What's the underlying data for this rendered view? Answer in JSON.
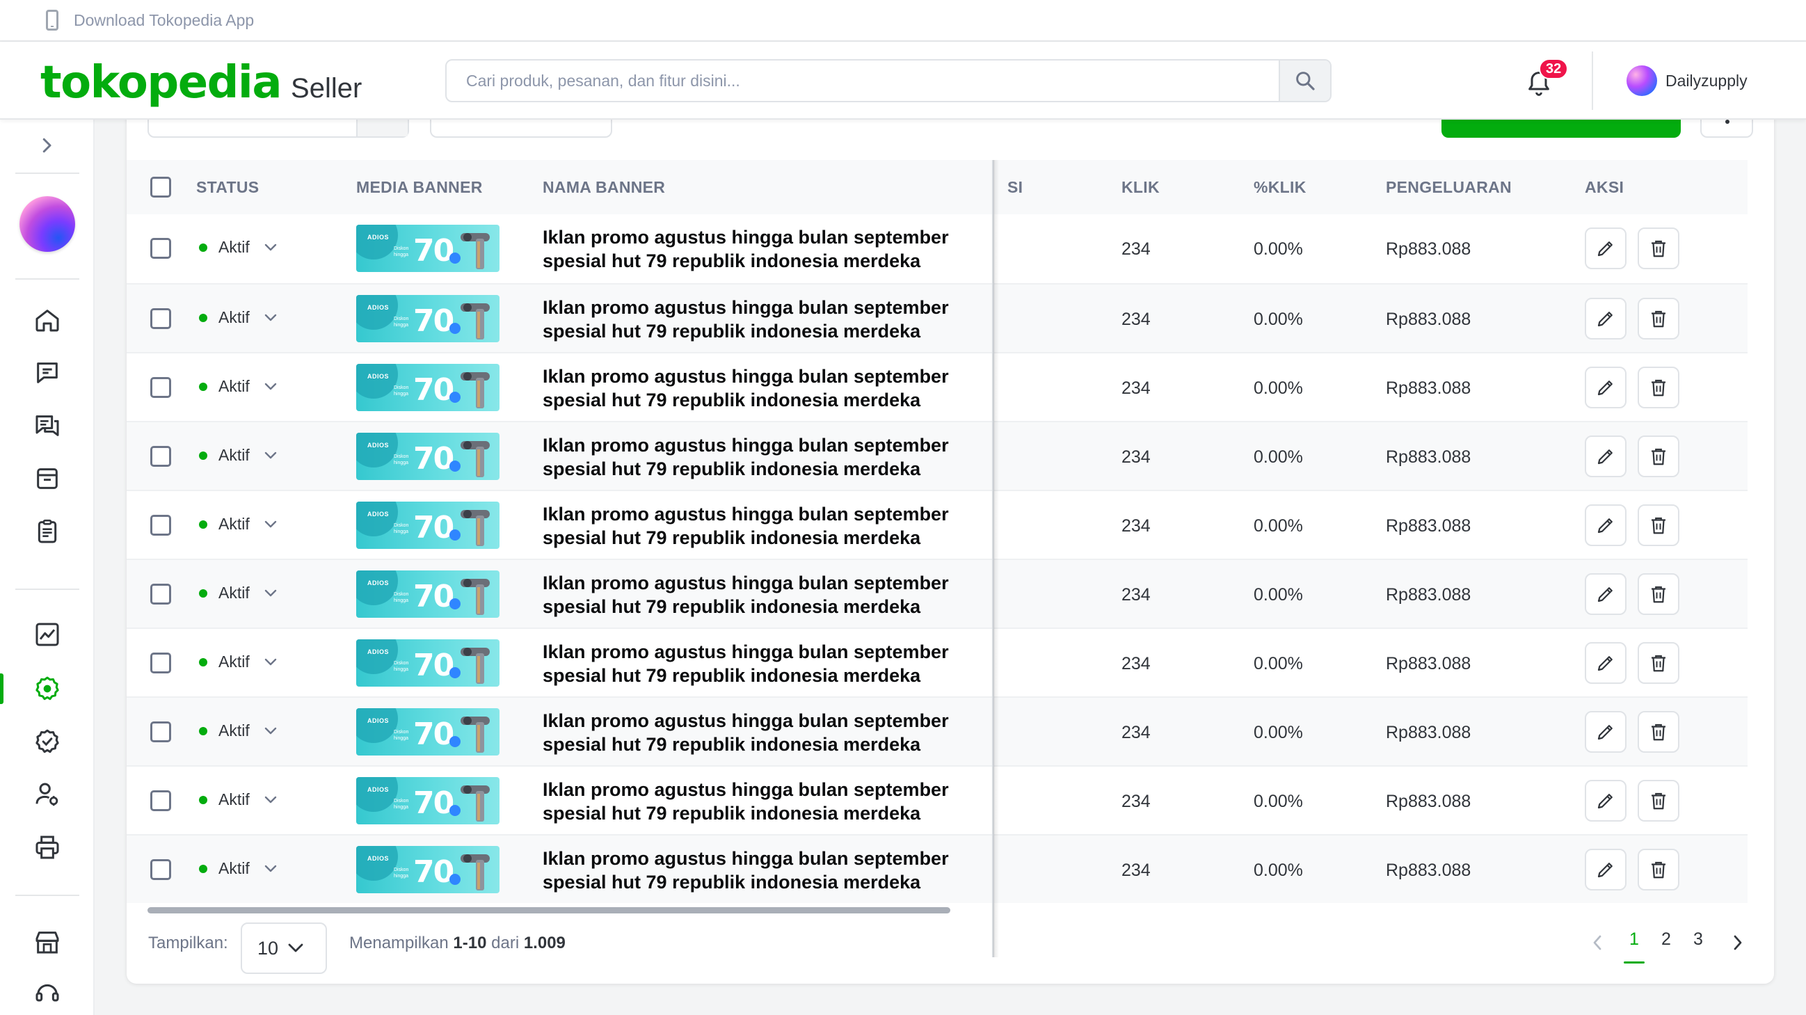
{
  "topbar": {
    "download_label": "Download Tokopedia App"
  },
  "header": {
    "brand": "tokopedia",
    "product": "Seller",
    "search_placeholder": "Cari produk, pesanan, dan fitur disini...",
    "notification_count": "32",
    "username": "Dailyzupply"
  },
  "sidebar": {
    "icons": [
      "home-icon",
      "chat-icon",
      "discussion-icon",
      "store-icon",
      "order-list-icon",
      "statistics-icon",
      "ads-icon",
      "badge-icon",
      "user-settings-icon",
      "printer-icon",
      "shop-decor-icon",
      "support-icon"
    ],
    "active": "ads-icon"
  },
  "table": {
    "headers": {
      "status": "STATUS",
      "media": "MEDIA BANNER",
      "name": "NAMA BANNER",
      "partial": "SI",
      "klik": "KLIK",
      "pct_klik": "%KLIK",
      "spend": "PENGELUARAN",
      "actions": "AKSI"
    },
    "banner_art": {
      "brand": "ADIOS",
      "small1": "Diskon",
      "small2": "hingga",
      "big": "70"
    },
    "rows": [
      {
        "status": "Aktif",
        "name1": "Iklan promo agustus hingga bulan september",
        "name2": "spesial hut 79 republik indonesia merdeka",
        "klik": "234",
        "pct": "0.00%",
        "spend": "Rp883.088"
      },
      {
        "status": "Aktif",
        "name1": "Iklan promo agustus hingga bulan september",
        "name2": "spesial hut 79 republik indonesia merdeka",
        "klik": "234",
        "pct": "0.00%",
        "spend": "Rp883.088"
      },
      {
        "status": "Aktif",
        "name1": "Iklan promo agustus hingga bulan september",
        "name2": "spesial hut 79 republik indonesia merdeka",
        "klik": "234",
        "pct": "0.00%",
        "spend": "Rp883.088"
      },
      {
        "status": "Aktif",
        "name1": "Iklan promo agustus hingga bulan september",
        "name2": "spesial hut 79 republik indonesia merdeka",
        "klik": "234",
        "pct": "0.00%",
        "spend": "Rp883.088"
      },
      {
        "status": "Aktif",
        "name1": "Iklan promo agustus hingga bulan september",
        "name2": "spesial hut 79 republik indonesia merdeka",
        "klik": "234",
        "pct": "0.00%",
        "spend": "Rp883.088"
      },
      {
        "status": "Aktif",
        "name1": "Iklan promo agustus hingga bulan september",
        "name2": "spesial hut 79 republik indonesia merdeka",
        "klik": "234",
        "pct": "0.00%",
        "spend": "Rp883.088"
      },
      {
        "status": "Aktif",
        "name1": "Iklan promo agustus hingga bulan september",
        "name2": "spesial hut 79 republik indonesia merdeka",
        "klik": "234",
        "pct": "0.00%",
        "spend": "Rp883.088"
      },
      {
        "status": "Aktif",
        "name1": "Iklan promo agustus hingga bulan september",
        "name2": "spesial hut 79 republik indonesia merdeka",
        "klik": "234",
        "pct": "0.00%",
        "spend": "Rp883.088"
      },
      {
        "status": "Aktif",
        "name1": "Iklan promo agustus hingga bulan september",
        "name2": "spesial hut 79 republik indonesia merdeka",
        "klik": "234",
        "pct": "0.00%",
        "spend": "Rp883.088"
      },
      {
        "status": "Aktif",
        "name1": "Iklan promo agustus hingga bulan september",
        "name2": "spesial hut 79 republik indonesia merdeka",
        "klik": "234",
        "pct": "0.00%",
        "spend": "Rp883.088"
      }
    ]
  },
  "footer": {
    "show_label": "Tampilkan:",
    "per_page": "10",
    "showing_prefix": "Menampilkan",
    "showing_range": "1-10",
    "showing_mid": "dari",
    "showing_total": "1.009",
    "pages": [
      "1",
      "2",
      "3"
    ],
    "current_page": "1"
  },
  "colors": {
    "brand_green": "#03ac0e",
    "badge_red": "#ef144a",
    "header_text": "#6d7588"
  }
}
